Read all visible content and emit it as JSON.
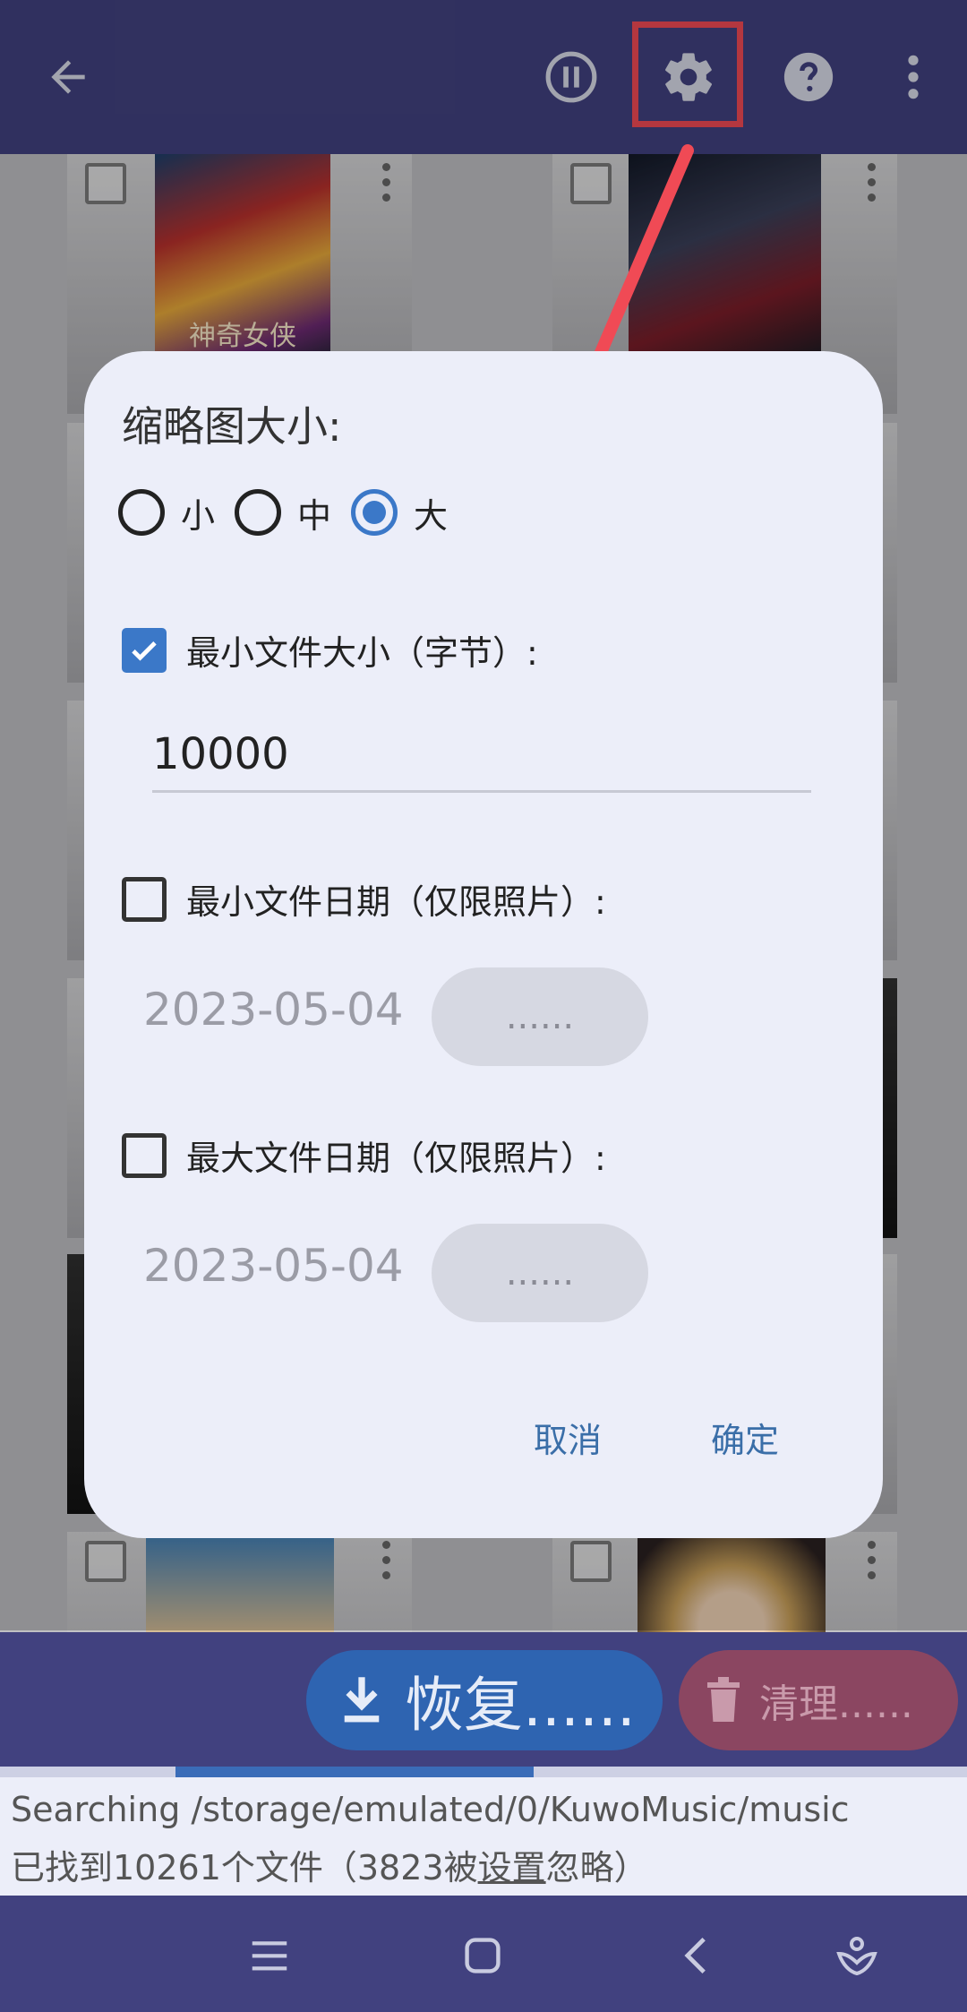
{
  "colors": {
    "primary": "#41417f",
    "accent": "#3b78c8",
    "dialog_bg": "#eceef9",
    "highlight": "#f04a55",
    "restore_button": "#2e64b1",
    "clean_button": "#8b4661"
  },
  "toolbar": {
    "icons": [
      "back-arrow-icon",
      "pause-icon",
      "gear-icon",
      "help-icon",
      "more-vert-icon"
    ]
  },
  "grid": {
    "thumbnail_text": "神奇女侠"
  },
  "dialog": {
    "title": "缩略图大小:",
    "thumbnail_sizes": [
      {
        "label": "小",
        "checked": false
      },
      {
        "label": "中",
        "checked": false
      },
      {
        "label": "大",
        "checked": true
      }
    ],
    "min_size": {
      "label": "最小文件大小（字节）:",
      "checked": true,
      "value": "10000"
    },
    "min_date": {
      "label": "最小文件日期（仅限照片）:",
      "checked": false,
      "date": "2023-05-04",
      "button": "......"
    },
    "max_date": {
      "label": "最大文件日期（仅限照片）:",
      "checked": false,
      "date": "2023-05-04",
      "button": "......"
    },
    "cancel": "取消",
    "ok": "确定"
  },
  "actions": {
    "restore": "恢复......",
    "clean": "清理......",
    "progress": 0.37
  },
  "status": {
    "line1": "Searching /storage/emulated/0/KuwoMusic/music",
    "line2_prefix": "已找到10261个文件（3823被",
    "line2_link": "设置",
    "line2_suffix": "忽略）"
  },
  "navbar": {
    "icons": [
      "menu-icon",
      "home-icon",
      "back-icon",
      "assistant-icon"
    ]
  }
}
